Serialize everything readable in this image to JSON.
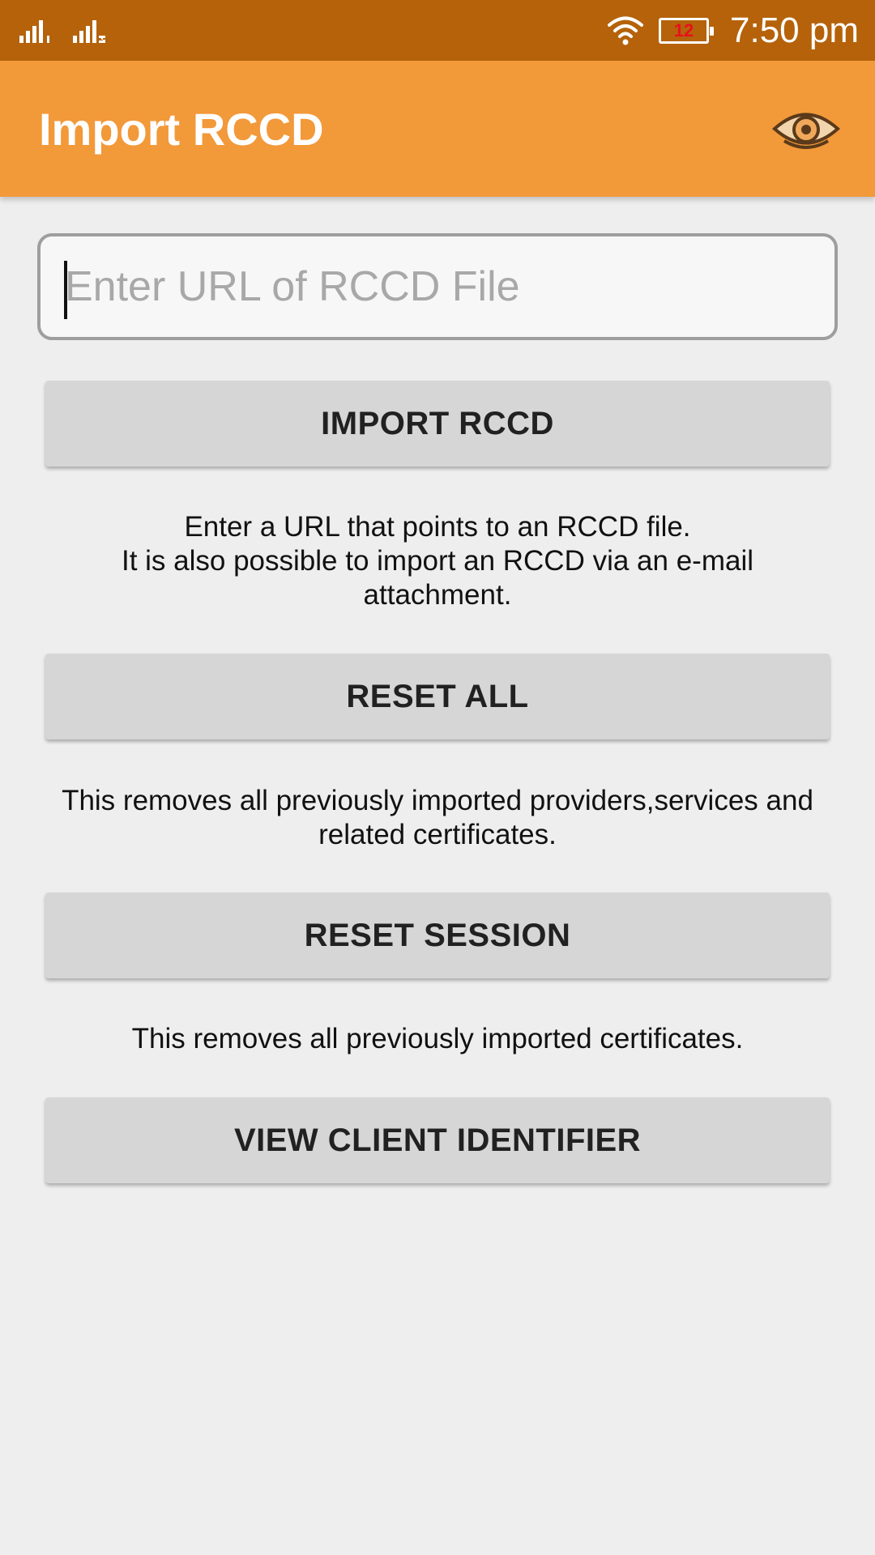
{
  "status_bar": {
    "sim1_icon": "signal-strength-icon",
    "sim2_icon": "signal-strength-icon",
    "wifi_icon": "wifi-icon",
    "battery_level": "12",
    "time": "7:50 pm"
  },
  "app_bar": {
    "title": "Import RCCD",
    "action_icon": "eye-icon"
  },
  "url_field": {
    "value": "",
    "placeholder": "Enter URL of RCCD File"
  },
  "import_section": {
    "button_label": "IMPORT RCCD",
    "description_lines": [
      "Enter a URL that points to an RCCD file.",
      "It is also possible to import an RCCD via an e-mail",
      "attachment."
    ]
  },
  "reset_all_section": {
    "button_label": "RESET ALL",
    "description_lines": [
      "This removes all previously imported providers,services and",
      "related certificates."
    ]
  },
  "reset_session_section": {
    "button_label": "RESET SESSION",
    "description_lines": [
      "This removes all previously imported certificates."
    ]
  },
  "view_client_section": {
    "button_label": "VIEW CLIENT IDENTIFIER"
  },
  "colors": {
    "status_bar": "#b5620a",
    "app_bar": "#f2993a",
    "background": "#eeeeee",
    "button": "#d6d6d6",
    "battery_text": "#e8101c"
  }
}
